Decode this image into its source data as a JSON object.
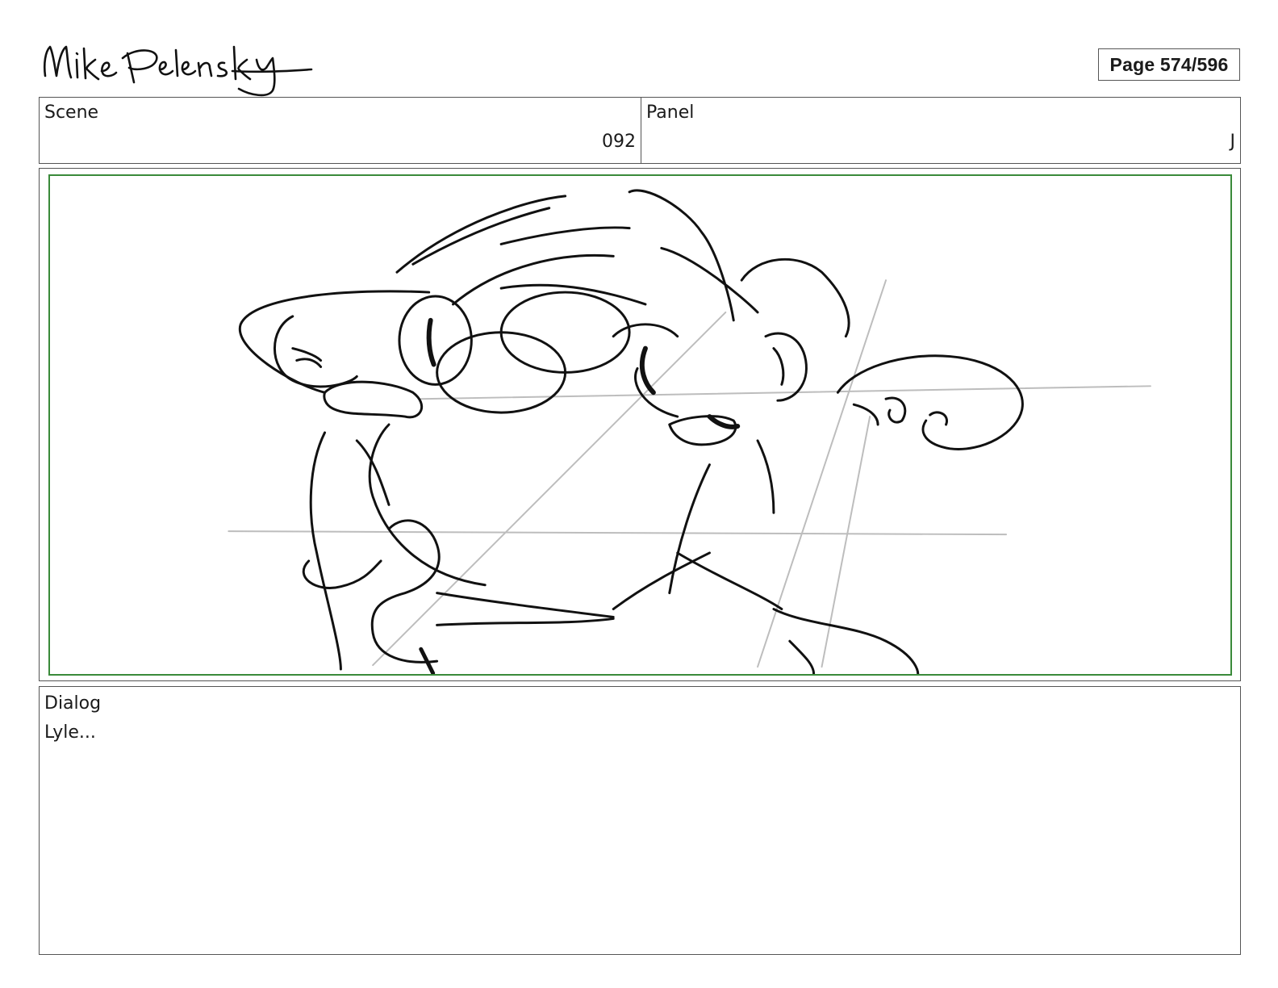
{
  "header": {
    "logo_text": "Mike Pelensky",
    "page_indicator": "Page 574/596"
  },
  "info": {
    "scene_label": "Scene",
    "scene_value": "092",
    "panel_label": "Panel",
    "panel_value": "J"
  },
  "dialog": {
    "label": "Dialog",
    "text": "Lyle..."
  },
  "colors": {
    "frame_border": "#3a8a3a",
    "box_border": "#555555"
  }
}
